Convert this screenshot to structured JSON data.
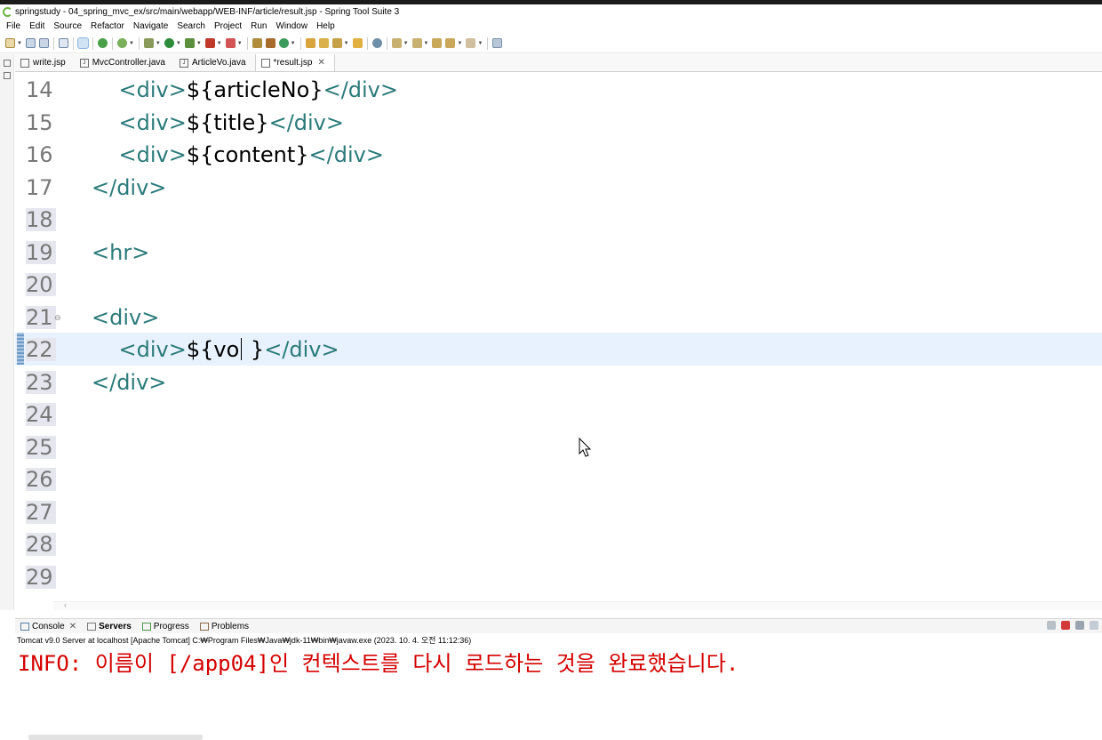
{
  "window": {
    "title": "springstudy - 04_spring_mvc_ex/src/main/webapp/WEB-INF/article/result.jsp - Spring Tool Suite 3"
  },
  "menu": [
    "File",
    "Edit",
    "Source",
    "Refactor",
    "Navigate",
    "Search",
    "Project",
    "Run",
    "Window",
    "Help"
  ],
  "editor_tabs": [
    {
      "label": "write.jsp",
      "active": false
    },
    {
      "label": "MvcController.java",
      "active": false
    },
    {
      "label": "ArticleVo.java",
      "active": false
    },
    {
      "label": "*result.jsp",
      "active": true
    }
  ],
  "editor": {
    "lines": [
      {
        "no": "14",
        "indent": "    ",
        "open": "<div>",
        "text": "${articleNo}",
        "close": "</div>"
      },
      {
        "no": "15",
        "indent": "    ",
        "open": "<div>",
        "text": "${title}",
        "close": "</div>"
      },
      {
        "no": "16",
        "indent": "    ",
        "open": "<div>",
        "text": "${content}",
        "close": "</div>"
      },
      {
        "no": "17",
        "indent": "",
        "open": "</div>",
        "text": "",
        "close": ""
      },
      {
        "no": "18",
        "indent": "",
        "open": "",
        "text": "",
        "close": ""
      },
      {
        "no": "19",
        "indent": "",
        "open": "<hr>",
        "text": "",
        "close": ""
      },
      {
        "no": "20",
        "indent": "",
        "open": "",
        "text": "",
        "close": ""
      },
      {
        "no": "21",
        "indent": "",
        "open": "<div>",
        "text": "",
        "close": ""
      },
      {
        "no": "22",
        "indent": "    ",
        "open": "<div>",
        "text": "${vo",
        "text_after_caret": " }",
        "close": "</div>"
      },
      {
        "no": "23",
        "indent": "",
        "open": "</div>",
        "text": "",
        "close": ""
      },
      {
        "no": "24",
        "indent": "",
        "open": "",
        "text": "",
        "close": ""
      },
      {
        "no": "25",
        "indent": "",
        "open": "",
        "text": "",
        "close": ""
      },
      {
        "no": "26",
        "indent": "",
        "open": "",
        "text": "",
        "close": ""
      },
      {
        "no": "27",
        "indent": "",
        "open": "",
        "text": "",
        "close": ""
      },
      {
        "no": "28",
        "indent": "",
        "open": "",
        "text": "",
        "close": ""
      },
      {
        "no": "29",
        "indent": "",
        "open": "",
        "text": "",
        "close": ""
      }
    ],
    "current_line": "22",
    "fold_line": "21"
  },
  "console_tabs": [
    {
      "label": "Console",
      "closable": true
    },
    {
      "label": "Servers",
      "bold": true
    },
    {
      "label": "Progress"
    },
    {
      "label": "Problems"
    }
  ],
  "console": {
    "header": "Tomcat v9.0 Server at localhost [Apache Tomcat] C:₩Program Files₩Java₩jdk-11₩bin₩javaw.exe  (2023. 10. 4. 오전 11:12:36)",
    "message": "INFO: 이름이 [/app04]인 컨텍스트를 다시 로드하는 것을 완료했습니다."
  },
  "colors": {
    "tag": "#2b7a7a",
    "console_text": "#d40000",
    "current_line": "#e8f2fe"
  }
}
